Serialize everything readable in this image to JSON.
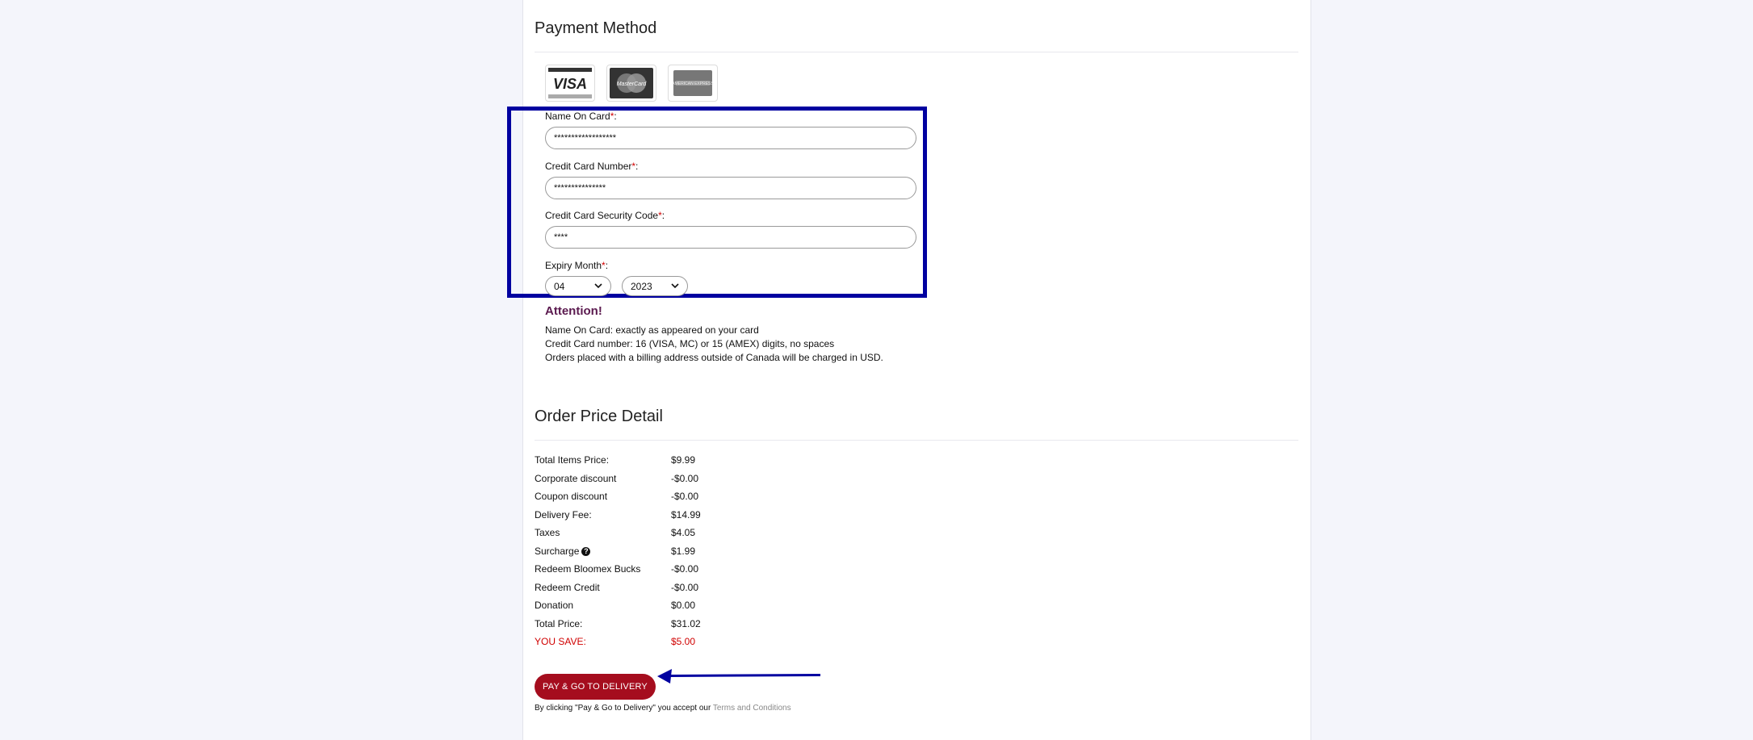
{
  "payment": {
    "title": "Payment Method",
    "card_icons": [
      "VISA",
      "MasterCard",
      "AMERICAN EXPRESS"
    ],
    "name_label": "Name On Card",
    "name_value": "******************",
    "number_label": "Credit Card Number",
    "number_value": "***************",
    "cvv_label": "Credit Card Security Code",
    "cvv_value": "****",
    "expiry_label": "Expiry Month",
    "expiry_month": "04",
    "expiry_year": "2023",
    "required_mark": "*",
    "colon": ":"
  },
  "attention": {
    "title": "Attention!",
    "lines": [
      "Name On Card: exactly as appeared on your card",
      "Credit Card number: 16 (VISA, MC) or 15 (AMEX) digits, no spaces",
      "Orders placed with a billing address outside of Canada will be charged in USD."
    ]
  },
  "order": {
    "title": "Order Price Detail",
    "rows": [
      {
        "label": "Total Items Price:",
        "value": "$9.99"
      },
      {
        "label": "Corporate discount",
        "value": "-$0.00"
      },
      {
        "label": "Coupon discount",
        "value": "-$0.00"
      },
      {
        "label": "Delivery Fee:",
        "value": "$14.99"
      },
      {
        "label": "Taxes",
        "value": "$4.05"
      },
      {
        "label": "Surcharge",
        "value": "$1.99"
      },
      {
        "label": "Redeem Bloomex Bucks",
        "value": "-$0.00"
      },
      {
        "label": "Redeem Credit",
        "value": "-$0.00"
      },
      {
        "label": "Donation",
        "value": "$0.00"
      },
      {
        "label": "Total Price:",
        "value": "$31.02"
      },
      {
        "label": "YOU SAVE:",
        "value": "$5.00"
      }
    ]
  },
  "actions": {
    "pay_label": "PAY & GO TO DELIVERY",
    "terms_prefix": "By clicking \"Pay & Go to Delivery\" you accept our ",
    "terms_link": "Terms and Conditions"
  },
  "icons": {
    "help": "question-circle-icon",
    "select_arrow": "chevron-down-icon",
    "annotation_arrow": "arrow-left-icon"
  },
  "colors": {
    "annotation": "#0000a0",
    "primary_button": "#a50d1e",
    "save_text": "#d00000",
    "attention_title": "#5b1a4f"
  }
}
